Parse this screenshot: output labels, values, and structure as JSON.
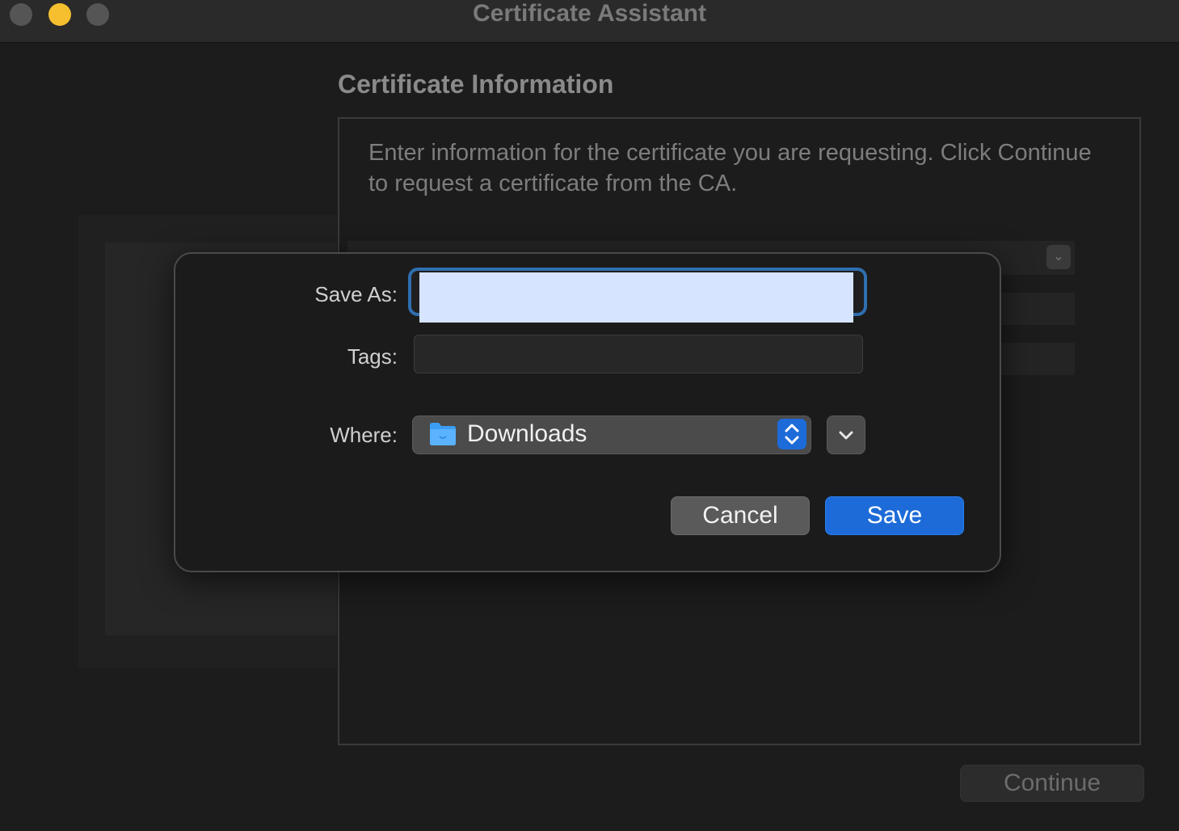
{
  "window": {
    "title": "Certificate Assistant"
  },
  "main": {
    "section_title": "Certificate Information",
    "info_text": "Enter information for the certificate you are requesting. Click Continue to request a certificate from the CA.",
    "continue_label": "Continue"
  },
  "save_sheet": {
    "save_as_label": "Save As:",
    "save_as_value": "",
    "tags_label": "Tags:",
    "tags_value": "",
    "where_label": "Where:",
    "where_value": "Downloads",
    "cancel_label": "Cancel",
    "save_label": "Save"
  },
  "colors": {
    "accent": "#1d6bd8",
    "minimize_light": "#f5bf2f",
    "selection": "#d6e4ff",
    "folder": "#3b9ef5"
  },
  "icons": {
    "folder": "folder-icon",
    "stepper": "chevron-up-down-icon",
    "expand": "chevron-down-icon"
  }
}
